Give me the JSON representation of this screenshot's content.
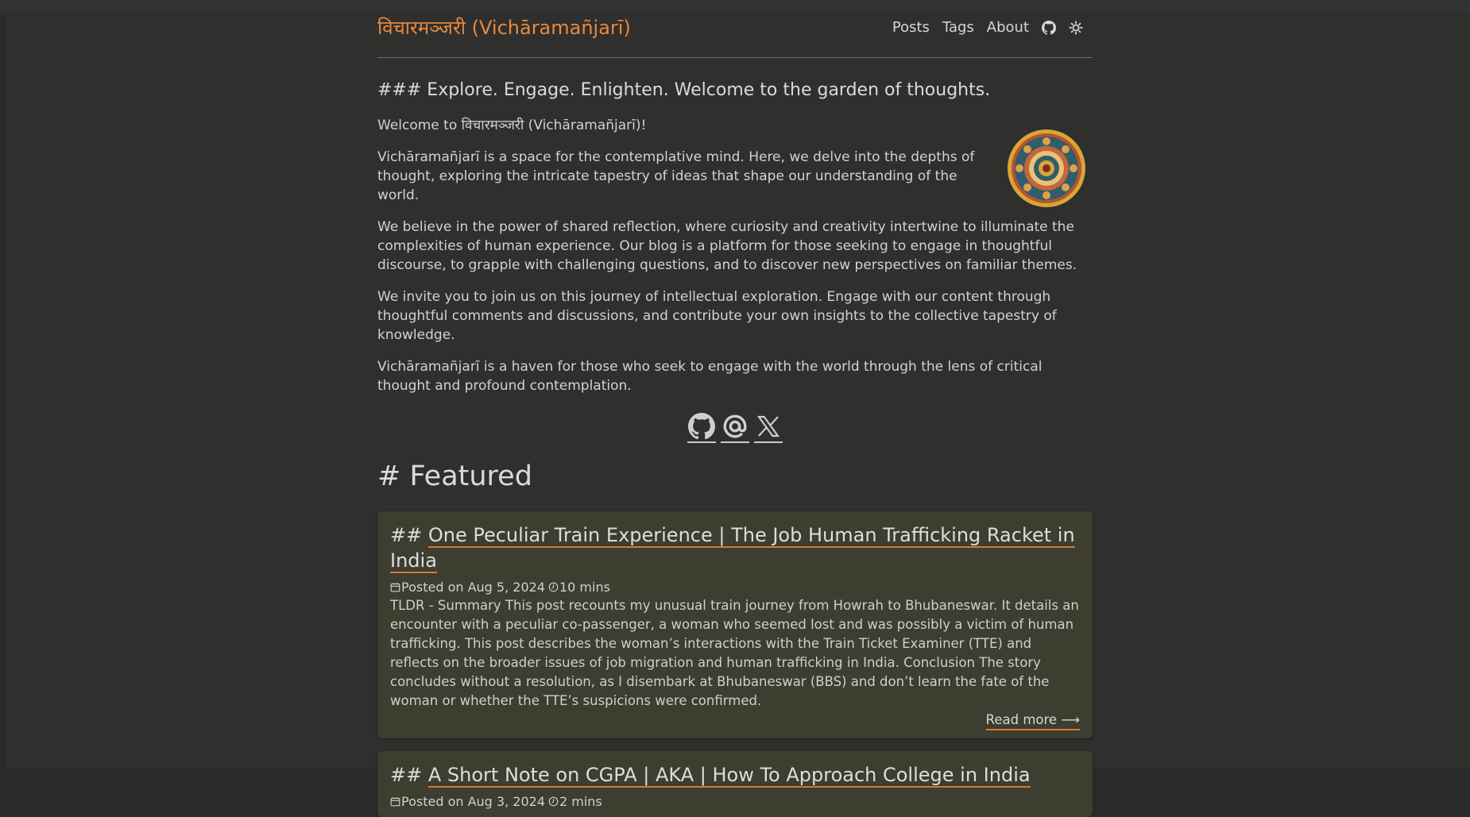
{
  "site": {
    "title": "विचारमञ्जरी (Vichāramañjarī)"
  },
  "nav": {
    "items": [
      {
        "label": "Posts"
      },
      {
        "label": "Tags"
      },
      {
        "label": "About"
      }
    ],
    "icons": [
      "github-icon",
      "theme-toggle-icon"
    ]
  },
  "hero": {
    "tagline": "### Explore. Engage. Enlighten. Welcome to the garden of thoughts.",
    "paragraphs": [
      "Welcome to विचारमञ्जरी (Vichāramañjarī)!",
      "Vichāramañjarī is a space for the contemplative mind. Here, we delve into the depths of thought, exploring the intricate tapestry of ideas that shape our understanding of the world.",
      "We believe in the power of shared reflection, where curiosity and creativity intertwine to illuminate the complexities of human experience. Our blog is a platform for those seeking to engage in thoughtful discourse, to grapple with challenging questions, and to discover new perspectives on familiar themes.",
      "We invite you to join us on this journey of intellectual exploration. Engage with our content through thoughtful comments and discussions, and contribute your own insights to the collective tapestry of knowledge.",
      "Vichāramañjarī is a haven for those who seek to engage with the world through the lens of critical thought and profound contemplation."
    ]
  },
  "social": {
    "icons": [
      "github-icon",
      "mail-at-icon",
      "x-icon"
    ]
  },
  "featured": {
    "heading": "# Featured",
    "posts": [
      {
        "title_prefix": "## ",
        "title": "One Peculiar Train Experience | The Job Human Trafficking Racket in India",
        "posted": "Posted on Aug 5, 2024",
        "read_time": "10 mins",
        "summary": "TLDR - Summary This post recounts my unusual train journey from Howrah to Bhubaneswar. It details an encounter with a peculiar co-passenger, a woman who seemed lost and was possibly a victim of human trafficking. This post describes the woman’s interactions with the Train Ticket Examiner (TTE) and reflects on the broader issues of job migration and human trafficking in India. Conclusion The story concludes without a resolution, as I disembark at Bhubaneswar (BBS) and don’t learn the fate of the woman or whether the TTE’s suspicions were confirmed.",
        "read_more": "Read more ⟶"
      },
      {
        "title_prefix": "## ",
        "title": "A Short Note on CGPA | AKA | How To Approach College in India",
        "posted": "Posted on Aug 3, 2024",
        "read_time": "2 mins"
      }
    ]
  },
  "colors": {
    "accent": "#e8893a",
    "underline": "#d77a2f",
    "background": "#2f2f2e",
    "card": "#3d3d30"
  }
}
